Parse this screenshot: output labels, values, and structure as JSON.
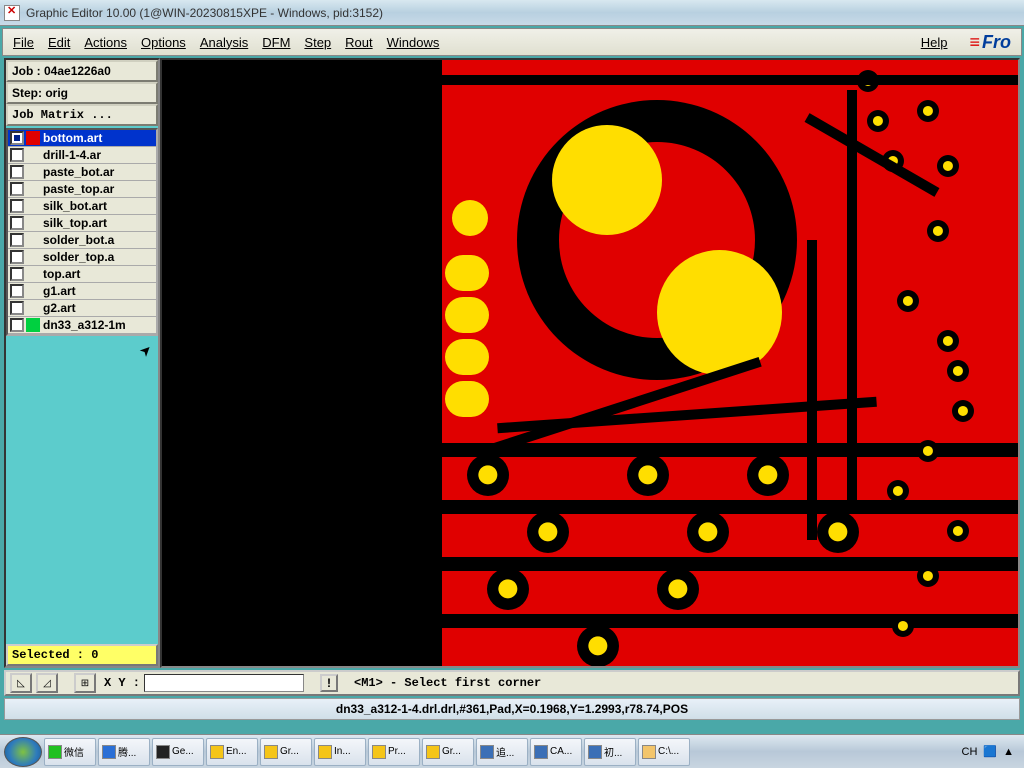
{
  "window": {
    "title": "Graphic Editor 10.00 (1@WIN-20230815XPE - Windows, pid:3152)"
  },
  "menus": {
    "file": "File",
    "edit": "Edit",
    "actions": "Actions",
    "options": "Options",
    "analysis": "Analysis",
    "dfm": "DFM",
    "step": "Step",
    "rout": "Rout",
    "windows": "Windows",
    "help": "Help"
  },
  "logo": "Fro",
  "job": {
    "label": "Job : ",
    "value": "04ae1226a0"
  },
  "step": {
    "label": "Step: ",
    "value": "orig"
  },
  "matrix_btn": "Job Matrix ...",
  "layers": [
    {
      "name": "bottom.art",
      "color": "#e00000",
      "selected": true,
      "checked": true
    },
    {
      "name": "drill-1-4.ar",
      "color": "#e8e8d8"
    },
    {
      "name": "paste_bot.ar",
      "color": "#e8e8d8"
    },
    {
      "name": "paste_top.ar",
      "color": "#e8e8d8"
    },
    {
      "name": "silk_bot.art",
      "color": "#e8e8d8"
    },
    {
      "name": "silk_top.art",
      "color": "#e8e8d8"
    },
    {
      "name": "solder_bot.a",
      "color": "#e8e8d8"
    },
    {
      "name": "solder_top.a",
      "color": "#e8e8d8"
    },
    {
      "name": "top.art",
      "color": "#e8e8d8"
    },
    {
      "name": "g1.art",
      "color": "#e8e8d8"
    },
    {
      "name": "g2.art",
      "color": "#e8e8d8"
    },
    {
      "name": "dn33_a312-1m",
      "color": "#00d040"
    }
  ],
  "selected_label": "Selected : 0",
  "xy_label": "X Y :",
  "prompt": "<M1> - Select first corner",
  "status2": "dn33_a312-1-4.drl.drl,#361,Pad,X=0.1968,Y=1.2993,r78.74,POS",
  "taskbar": [
    {
      "label": "微信",
      "color": "#20c020"
    },
    {
      "label": "腾...",
      "color": "#2a6fd6"
    },
    {
      "label": "Ge...",
      "color": "#222"
    },
    {
      "label": "En...",
      "color": "#f5c518"
    },
    {
      "label": "Gr...",
      "color": "#f5c518"
    },
    {
      "label": "In...",
      "color": "#f5c518"
    },
    {
      "label": "Pr...",
      "color": "#f5c518"
    },
    {
      "label": "Gr...",
      "color": "#f5c518"
    },
    {
      "label": "追...",
      "color": "#3b6fb6"
    },
    {
      "label": "CA...",
      "color": "#3b6fb6"
    },
    {
      "label": "初...",
      "color": "#3b6fb6"
    },
    {
      "label": "C:\\...",
      "color": "#f3c56b"
    }
  ],
  "tray": {
    "ime": "CH"
  }
}
